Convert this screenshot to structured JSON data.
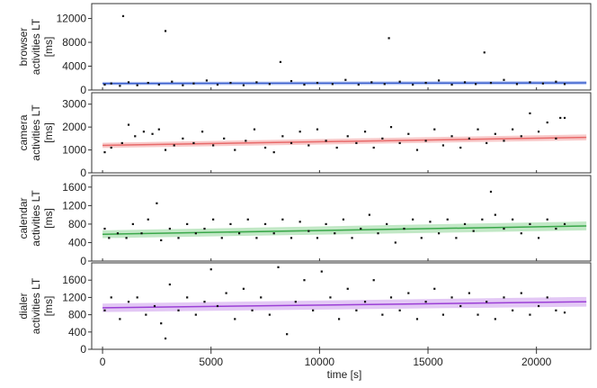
{
  "chart_data": [
    {
      "type": "scatter",
      "ylabel_lines": [
        "browser",
        "activities LT",
        "[ms]"
      ],
      "ylim": [
        0,
        14500
      ],
      "yticks": [
        0,
        4000,
        8000,
        12000
      ],
      "fit_color": "#3a5fcd",
      "band_color": "#a9bbf0",
      "fit": {
        "start": 1100,
        "end": 1200
      },
      "band": 200,
      "points": [
        [
          950,
          12400
        ],
        [
          2900,
          9900
        ],
        [
          8200,
          4700
        ],
        [
          13200,
          8700
        ],
        [
          17600,
          6300
        ],
        [
          100,
          900
        ],
        [
          400,
          1100
        ],
        [
          800,
          700
        ],
        [
          1200,
          1300
        ],
        [
          1600,
          800
        ],
        [
          2100,
          1200
        ],
        [
          2600,
          900
        ],
        [
          3200,
          1400
        ],
        [
          3700,
          800
        ],
        [
          4200,
          1100
        ],
        [
          4800,
          1600
        ],
        [
          5300,
          900
        ],
        [
          5900,
          1200
        ],
        [
          6500,
          800
        ],
        [
          7100,
          1300
        ],
        [
          7700,
          1000
        ],
        [
          8700,
          1500
        ],
        [
          9300,
          900
        ],
        [
          9900,
          1200
        ],
        [
          10600,
          1000
        ],
        [
          11200,
          1700
        ],
        [
          11800,
          900
        ],
        [
          12400,
          1300
        ],
        [
          13000,
          1000
        ],
        [
          13700,
          1400
        ],
        [
          14300,
          900
        ],
        [
          14900,
          1200
        ],
        [
          15500,
          1600
        ],
        [
          16100,
          900
        ],
        [
          16700,
          1300
        ],
        [
          17200,
          1000
        ],
        [
          17900,
          1200
        ],
        [
          18500,
          1700
        ],
        [
          19100,
          1000
        ],
        [
          19700,
          1300
        ],
        [
          20300,
          1100
        ],
        [
          20900,
          1400
        ],
        [
          21300,
          1000
        ]
      ]
    },
    {
      "type": "scatter",
      "ylabel_lines": [
        "camera",
        "activities LT",
        "[ms]"
      ],
      "ylim": [
        0,
        3500
      ],
      "yticks": [
        0,
        1000,
        2000,
        3000
      ],
      "fit_color": "#e86a6a",
      "band_color": "#f6b8b8",
      "fit": {
        "start": 1200,
        "end": 1550
      },
      "band": 80,
      "points": [
        [
          100,
          900
        ],
        [
          400,
          1100
        ],
        [
          900,
          1300
        ],
        [
          1200,
          2100
        ],
        [
          1500,
          1600
        ],
        [
          1900,
          1800
        ],
        [
          2300,
          1700
        ],
        [
          2600,
          1900
        ],
        [
          2900,
          1000
        ],
        [
          3300,
          1200
        ],
        [
          3700,
          1500
        ],
        [
          4200,
          1300
        ],
        [
          4600,
          1800
        ],
        [
          5100,
          1200
        ],
        [
          5600,
          1500
        ],
        [
          6100,
          1000
        ],
        [
          6600,
          1400
        ],
        [
          7000,
          1900
        ],
        [
          7500,
          1100
        ],
        [
          7900,
          900
        ],
        [
          8300,
          1600
        ],
        [
          8700,
          1300
        ],
        [
          9100,
          1800
        ],
        [
          9500,
          1200
        ],
        [
          9900,
          1900
        ],
        [
          10300,
          1400
        ],
        [
          10800,
          1100
        ],
        [
          11300,
          1600
        ],
        [
          11700,
          1300
        ],
        [
          12100,
          1800
        ],
        [
          12500,
          1100
        ],
        [
          12900,
          1500
        ],
        [
          13300,
          2000
        ],
        [
          13700,
          1300
        ],
        [
          14100,
          1700
        ],
        [
          14500,
          1000
        ],
        [
          14900,
          1400
        ],
        [
          15300,
          1900
        ],
        [
          15700,
          1200
        ],
        [
          16100,
          1600
        ],
        [
          16500,
          1100
        ],
        [
          16900,
          1500
        ],
        [
          17300,
          1900
        ],
        [
          17700,
          1300
        ],
        [
          18100,
          1700
        ],
        [
          18500,
          1400
        ],
        [
          18900,
          1900
        ],
        [
          19300,
          1600
        ],
        [
          19700,
          2600
        ],
        [
          20100,
          1800
        ],
        [
          20500,
          2200
        ],
        [
          20900,
          1500
        ],
        [
          21100,
          2400
        ],
        [
          21300,
          2400
        ]
      ]
    },
    {
      "type": "scatter",
      "ylabel_lines": [
        "calendar",
        "activities LT",
        "[ms]"
      ],
      "ylim": [
        0,
        1850
      ],
      "yticks": [
        0,
        400,
        800,
        1200,
        1600
      ],
      "fit_color": "#3aa84a",
      "band_color": "#aee0b3",
      "fit": {
        "start": 580,
        "end": 760
      },
      "band": 60,
      "points": [
        [
          100,
          700
        ],
        [
          300,
          500
        ],
        [
          700,
          600
        ],
        [
          1100,
          500
        ],
        [
          1400,
          800
        ],
        [
          1800,
          600
        ],
        [
          2100,
          900
        ],
        [
          2500,
          1250
        ],
        [
          2700,
          450
        ],
        [
          3100,
          700
        ],
        [
          3500,
          500
        ],
        [
          3900,
          800
        ],
        [
          4300,
          600
        ],
        [
          4700,
          700
        ],
        [
          5100,
          900
        ],
        [
          5500,
          500
        ],
        [
          5900,
          800
        ],
        [
          6300,
          600
        ],
        [
          6700,
          900
        ],
        [
          7100,
          500
        ],
        [
          7500,
          800
        ],
        [
          7900,
          600
        ],
        [
          8300,
          900
        ],
        [
          8700,
          500
        ],
        [
          9100,
          850
        ],
        [
          9500,
          650
        ],
        [
          9900,
          500
        ],
        [
          10300,
          800
        ],
        [
          10700,
          600
        ],
        [
          11100,
          900
        ],
        [
          11500,
          500
        ],
        [
          11900,
          700
        ],
        [
          12300,
          1000
        ],
        [
          12700,
          600
        ],
        [
          13100,
          800
        ],
        [
          13500,
          400
        ],
        [
          13900,
          700
        ],
        [
          14300,
          900
        ],
        [
          14700,
          500
        ],
        [
          15100,
          850
        ],
        [
          15500,
          600
        ],
        [
          15900,
          900
        ],
        [
          16300,
          500
        ],
        [
          16700,
          800
        ],
        [
          17100,
          650
        ],
        [
          17500,
          900
        ],
        [
          17900,
          1500
        ],
        [
          18100,
          1000
        ],
        [
          18500,
          700
        ],
        [
          18900,
          900
        ],
        [
          19300,
          600
        ],
        [
          19700,
          800
        ],
        [
          20100,
          500
        ],
        [
          20500,
          900
        ],
        [
          20900,
          700
        ],
        [
          21300,
          800
        ]
      ]
    },
    {
      "type": "scatter",
      "ylabel_lines": [
        "dialer",
        "activities LT",
        "[ms]"
      ],
      "ylim": [
        0,
        2000
      ],
      "yticks": [
        0,
        400,
        800,
        1200,
        1600
      ],
      "fit_color": "#9b3fd6",
      "band_color": "#d9b6f2",
      "fit": {
        "start": 960,
        "end": 1100
      },
      "band": 70,
      "points": [
        [
          100,
          900
        ],
        [
          400,
          1200
        ],
        [
          800,
          700
        ],
        [
          1200,
          1100
        ],
        [
          1600,
          1200
        ],
        [
          2000,
          800
        ],
        [
          2400,
          1000
        ],
        [
          2700,
          600
        ],
        [
          2900,
          250
        ],
        [
          3100,
          1500
        ],
        [
          3500,
          900
        ],
        [
          3900,
          1200
        ],
        [
          4300,
          800
        ],
        [
          4700,
          1100
        ],
        [
          5000,
          1850
        ],
        [
          5300,
          1000
        ],
        [
          5700,
          1300
        ],
        [
          6100,
          700
        ],
        [
          6500,
          1400
        ],
        [
          6900,
          900
        ],
        [
          7300,
          1200
        ],
        [
          7700,
          800
        ],
        [
          8100,
          1900
        ],
        [
          8500,
          350
        ],
        [
          8900,
          1100
        ],
        [
          9300,
          1600
        ],
        [
          9700,
          900
        ],
        [
          10100,
          1800
        ],
        [
          10500,
          1200
        ],
        [
          10900,
          700
        ],
        [
          11300,
          1400
        ],
        [
          11700,
          900
        ],
        [
          12100,
          1100
        ],
        [
          12500,
          1600
        ],
        [
          12900,
          800
        ],
        [
          13300,
          1200
        ],
        [
          13700,
          900
        ],
        [
          14100,
          1300
        ],
        [
          14500,
          700
        ],
        [
          14900,
          1100
        ],
        [
          15300,
          1400
        ],
        [
          15700,
          800
        ],
        [
          16100,
          1200
        ],
        [
          16500,
          1000
        ],
        [
          16900,
          1300
        ],
        [
          17300,
          800
        ],
        [
          17700,
          1100
        ],
        [
          18100,
          700
        ],
        [
          18500,
          1200
        ],
        [
          18900,
          900
        ],
        [
          19300,
          1300
        ],
        [
          19700,
          800
        ],
        [
          20100,
          1000
        ],
        [
          20500,
          1200
        ],
        [
          20900,
          900
        ],
        [
          21300,
          850
        ]
      ]
    }
  ],
  "xaxis": {
    "label": "time [s]",
    "xlim": [
      -500,
      22500
    ],
    "ticks": [
      0,
      5000,
      10000,
      15000,
      20000
    ]
  }
}
